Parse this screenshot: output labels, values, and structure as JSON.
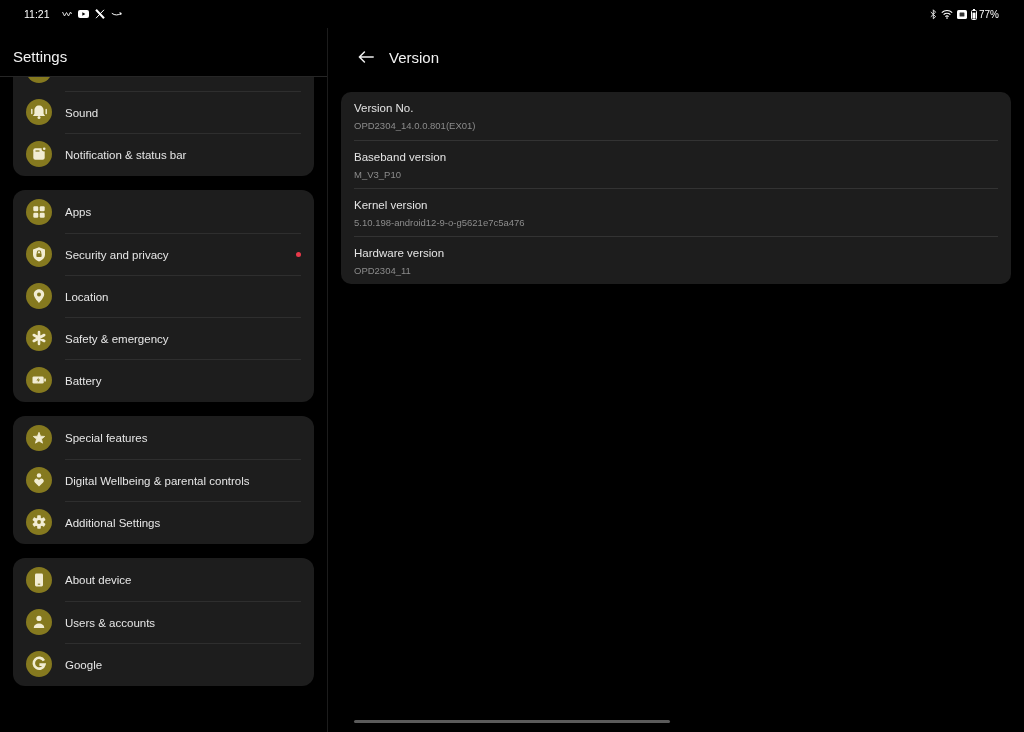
{
  "status_bar": {
    "time": "11:21",
    "battery": "77%"
  },
  "settings_pane": {
    "title": "Settings",
    "groups": [
      {
        "items": [
          {
            "kind": "cut"
          },
          {
            "kind": "row",
            "label": "Sound",
            "alert_dot": false
          },
          {
            "kind": "row",
            "label": "Notification & status bar",
            "alert_dot": false
          }
        ]
      },
      {
        "items": [
          {
            "kind": "row",
            "label": "Apps",
            "alert_dot": false
          },
          {
            "kind": "row",
            "label": "Security and privacy",
            "alert_dot": true
          },
          {
            "kind": "row",
            "label": "Location",
            "alert_dot": false
          },
          {
            "kind": "row",
            "label": "Safety & emergency",
            "alert_dot": false
          },
          {
            "kind": "row",
            "label": "Battery",
            "alert_dot": false
          }
        ]
      },
      {
        "items": [
          {
            "kind": "row",
            "label": "Special features",
            "alert_dot": false
          },
          {
            "kind": "row",
            "label": "Digital Wellbeing & parental controls",
            "alert_dot": false
          },
          {
            "kind": "row",
            "label": "Additional Settings",
            "alert_dot": false
          }
        ]
      },
      {
        "items": [
          {
            "kind": "row",
            "label": "About device",
            "alert_dot": false
          },
          {
            "kind": "row",
            "label": "Users & accounts",
            "alert_dot": false
          },
          {
            "kind": "row",
            "label": "Google",
            "alert_dot": false
          }
        ]
      }
    ]
  },
  "detail_pane": {
    "title": "Version",
    "rows": [
      {
        "label": "Version No.",
        "value": "OPD2304_14.0.0.801(EX01)"
      },
      {
        "label": "Baseband version",
        "value": "M_V3_P10"
      },
      {
        "label": "Kernel version",
        "value": "5.10.198-android12-9-o-g5621e7c5a476"
      },
      {
        "label": "Hardware version",
        "value": "OPD2304_11"
      }
    ]
  }
}
